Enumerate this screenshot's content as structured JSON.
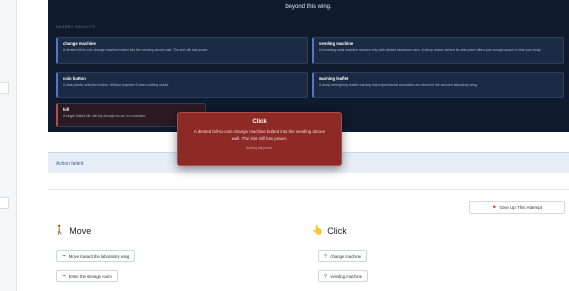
{
  "scene": {
    "top_text": "beyond this wing.",
    "objects_heading": "NEARBY OBJECTS",
    "objects": [
      {
        "name": "change machine",
        "description": "A dented bill-to-coin change machine bolted into the vending alcove wall. The slot still has power."
      },
      {
        "name": "vending machine",
        "description": "A humming soda machine stocked only with dented aluminum cans. A steep recess behind its side panel offers just enough space to hide your body."
      },
      {
        "name": "coin button",
        "description": "A dark plastic selection button. Without payment it does nothing useful."
      },
      {
        "name": "warning leaflet",
        "description": "A damp emergency leaflet warning that experimental anomalies are stored in the secured laboratory wing."
      },
      {
        "name": "bill",
        "description": "A single folded bill, still dry enough to use in a machine."
      }
    ]
  },
  "status": {
    "message": "Action failed."
  },
  "give_up": {
    "label": "Give Up This Attempt"
  },
  "move": {
    "title": "Move",
    "actions": [
      "Move toward the laboratory wing",
      "Enter the storage room"
    ]
  },
  "click": {
    "title": "Click",
    "actions": [
      "change machine",
      "vending machine"
    ]
  },
  "modal": {
    "title": "Click",
    "body": "A dented bill-to-coin change machine bolted into the vending alcove wall. The slot still has power.",
    "footer": "Nothing happened."
  },
  "colors": {
    "scene_bg": "#0f1a2c",
    "modal_bg": "#8e2a25",
    "status_bg": "#e8eef8",
    "accent": "#3b7ddd"
  }
}
